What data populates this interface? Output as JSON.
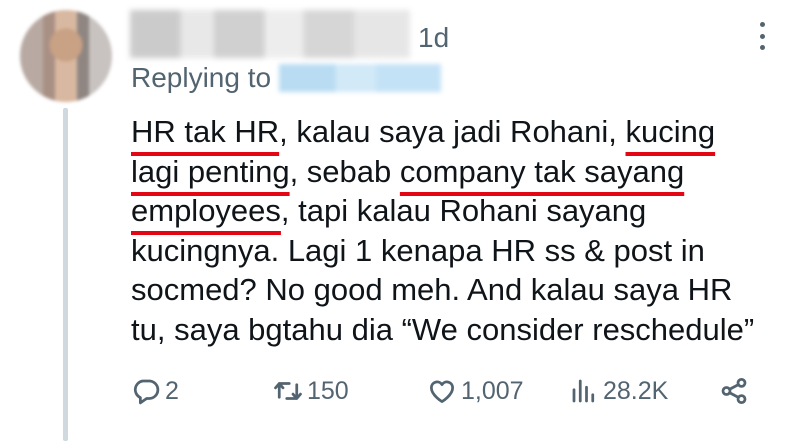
{
  "tweet": {
    "time": "1d",
    "replying_prefix": "Replying to",
    "lines": [
      [
        "HR tak HR",
        ", kalau saya jadi Rohani, ",
        "kucing"
      ],
      [
        "lagi penting",
        ", sebab ",
        "company tak sayang"
      ],
      [
        "employees",
        ", tapi kalau Rohani sayang"
      ],
      [
        "kucingnya. Lagi 1 kenapa HR ss & post in"
      ],
      [
        "socmed? No good meh. And kalau saya HR"
      ],
      [
        "tu, saya bgtahu dia “We consider reschedule”"
      ]
    ],
    "underline_color": "#e30613"
  },
  "actions": {
    "replies": "2",
    "retweets": "150",
    "likes": "1,007",
    "views": "28.2K",
    "icons": [
      "reply-icon",
      "retweet-icon",
      "like-icon",
      "views-icon",
      "share-icon"
    ]
  }
}
